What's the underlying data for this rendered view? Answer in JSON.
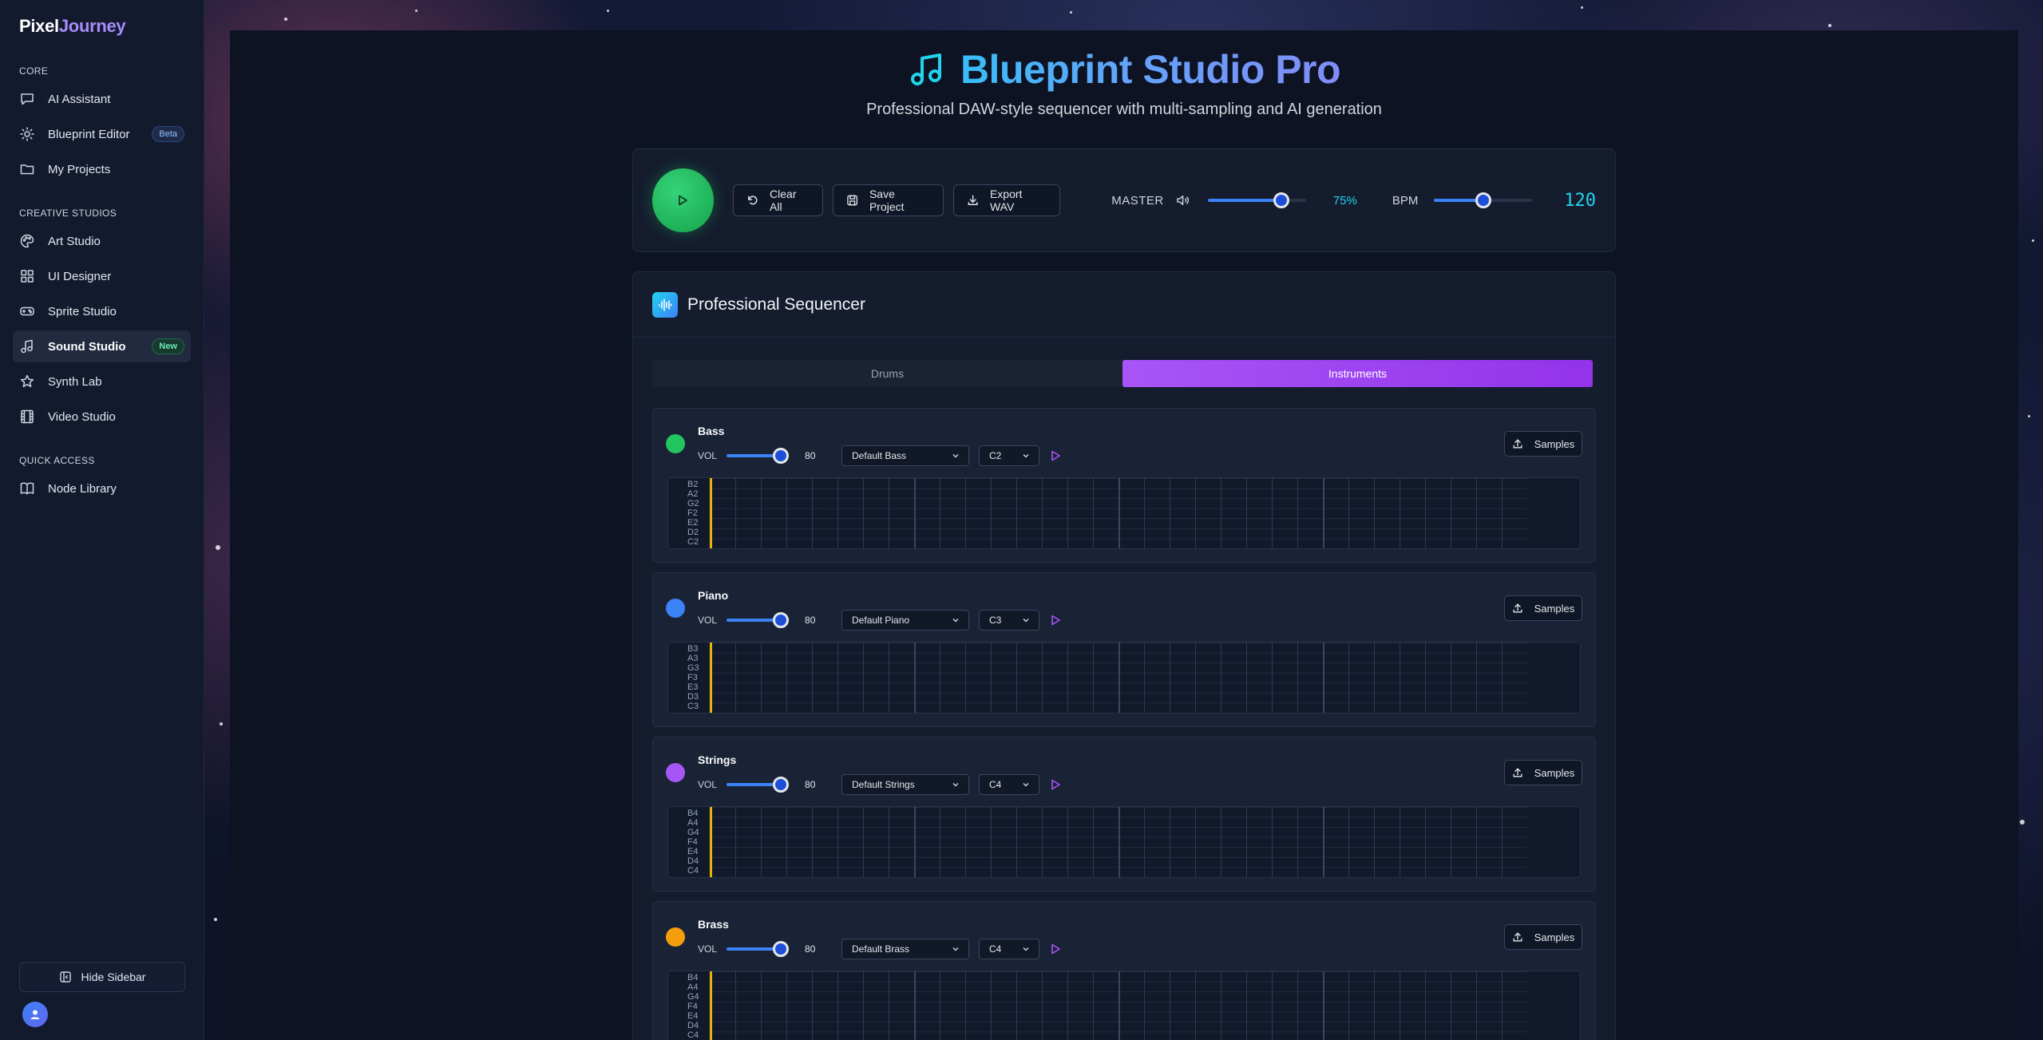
{
  "brand": {
    "first": "Pixel",
    "second": "Journey"
  },
  "sidebar": {
    "sections": [
      {
        "label": "CORE",
        "items": [
          {
            "label": "AI Assistant",
            "icon": "chat-icon"
          },
          {
            "label": "Blueprint Editor",
            "icon": "gear-icon",
            "badge": "Beta"
          },
          {
            "label": "My Projects",
            "icon": "folder-icon"
          }
        ]
      },
      {
        "label": "CREATIVE STUDIOS",
        "items": [
          {
            "label": "Art Studio",
            "icon": "palette-icon"
          },
          {
            "label": "UI Designer",
            "icon": "grid-icon"
          },
          {
            "label": "Sprite Studio",
            "icon": "gamepad-icon"
          },
          {
            "label": "Sound Studio",
            "icon": "music-icon",
            "badge": "New",
            "active": true
          },
          {
            "label": "Synth Lab",
            "icon": "star-icon"
          },
          {
            "label": "Video Studio",
            "icon": "film-icon"
          }
        ]
      },
      {
        "label": "QUICK ACCESS",
        "items": [
          {
            "label": "Node Library",
            "icon": "book-icon"
          }
        ]
      }
    ],
    "hide_label": "Hide Sidebar"
  },
  "header": {
    "title": "Blueprint Studio Pro",
    "subtitle": "Professional DAW-style sequencer with multi-sampling and AI generation"
  },
  "transport": {
    "clear_label": "Clear All",
    "save_label": "Save Project",
    "export_label": "Export WAV",
    "master_label": "MASTER",
    "master_value": 0.75,
    "master_pct": "75%",
    "bpm_label": "BPM",
    "bpm_slider_value": 0.5,
    "bpm_value": "120"
  },
  "sequencer": {
    "title": "Professional Sequencer",
    "tabs": [
      {
        "label": "Drums",
        "active": false
      },
      {
        "label": "Instruments",
        "active": true
      }
    ],
    "tracks": [
      {
        "name": "Bass",
        "color": "#22c55e",
        "vol_label": "VOL",
        "volume": "80",
        "sample": "Default Bass",
        "note": "C2",
        "samples_label": "Samples",
        "notes": [
          "B2",
          "A2",
          "G2",
          "F2",
          "E2",
          "D2",
          "C2"
        ]
      },
      {
        "name": "Piano",
        "color": "#3b82f6",
        "vol_label": "VOL",
        "volume": "80",
        "sample": "Default Piano",
        "note": "C3",
        "samples_label": "Samples",
        "notes": [
          "B3",
          "A3",
          "G3",
          "F3",
          "E3",
          "D3",
          "C3"
        ]
      },
      {
        "name": "Strings",
        "color": "#a855f7",
        "vol_label": "VOL",
        "volume": "80",
        "sample": "Default Strings",
        "note": "C4",
        "samples_label": "Samples",
        "notes": [
          "B4",
          "A4",
          "G4",
          "F4",
          "E4",
          "D4",
          "C4"
        ]
      },
      {
        "name": "Brass",
        "color": "#f59e0b",
        "vol_label": "VOL",
        "volume": "80",
        "sample": "Default Brass",
        "note": "C4",
        "samples_label": "Samples",
        "notes": [
          "B4",
          "A4",
          "G4",
          "F4",
          "E4",
          "D4",
          "C4"
        ]
      }
    ]
  }
}
